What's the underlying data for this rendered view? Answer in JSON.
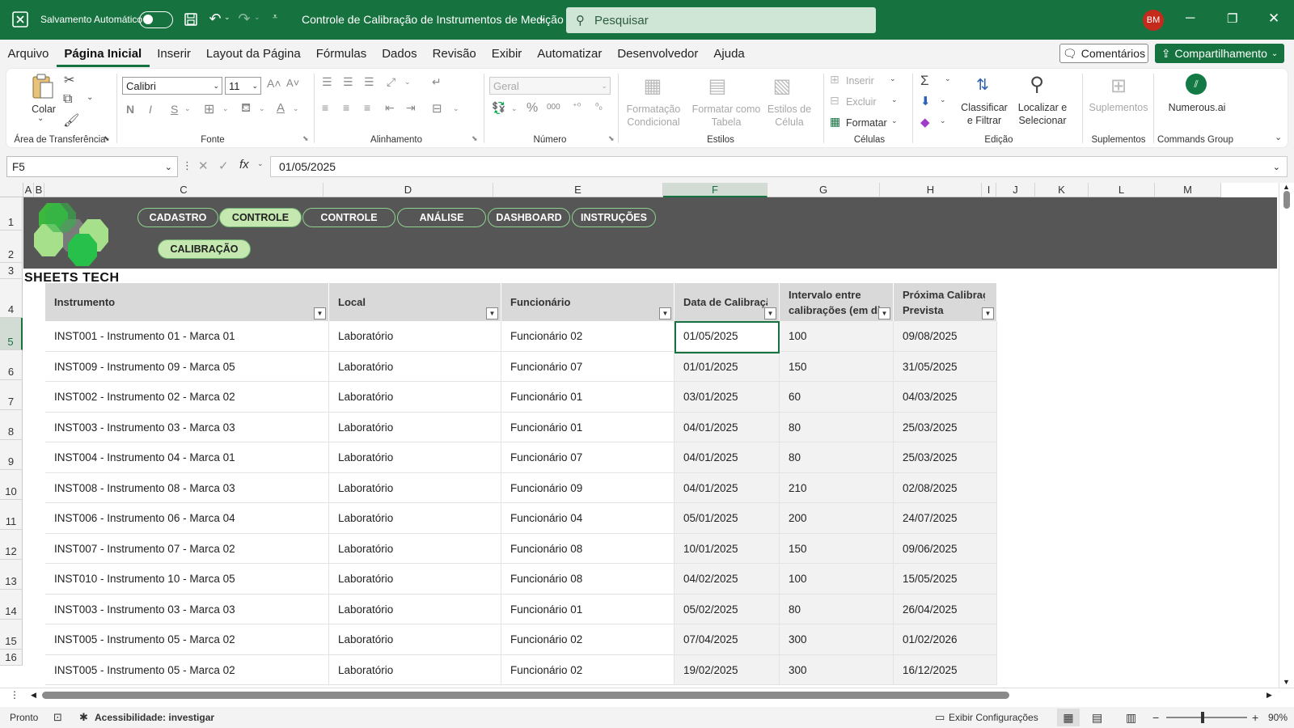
{
  "titlebar": {
    "autosave_label": "Salvamento Automático",
    "doc_title": "Controle de Calibração de Instrumentos de Medição",
    "search_placeholder": "Pesquisar",
    "user_initials": "BM"
  },
  "menu": [
    "Arquivo",
    "Página Inicial",
    "Inserir",
    "Layout da Página",
    "Fórmulas",
    "Dados",
    "Revisão",
    "Exibir",
    "Automatizar",
    "Desenvolvedor",
    "Ajuda"
  ],
  "menu_active_index": 1,
  "actions": {
    "comments": "Comentários",
    "share": "Compartilhamento"
  },
  "ribbon": {
    "clipboard": {
      "paste": "Colar",
      "label": "Área de Transferência"
    },
    "font": {
      "name": "Calibri",
      "size": "11",
      "label": "Fonte",
      "bold": "N",
      "italic": "I",
      "underline": "S"
    },
    "alignment": {
      "label": "Alinhamento"
    },
    "number": {
      "format": "Geral",
      "label": "Número"
    },
    "styles": {
      "cond_format": "Formatação Condicional",
      "format_table": "Formatar como Tabela",
      "cell_styles": "Estilos de Célula",
      "label": "Estilos"
    },
    "cells": {
      "insert": "Inserir",
      "delete": "Excluir",
      "format": "Formatar",
      "label": "Células"
    },
    "editing": {
      "sort": "Classificar e Filtrar",
      "find": "Localizar e Selecionar",
      "label": "Edição"
    },
    "addins": {
      "addins": "Suplementos",
      "label": "Suplementos"
    },
    "commands": {
      "numerous": "Numerous.ai",
      "label": "Commands Group"
    }
  },
  "formula_bar": {
    "name_box": "F5",
    "formula": "01/05/2025"
  },
  "columns": [
    "A",
    "B",
    "C",
    "D",
    "E",
    "F",
    "G",
    "H",
    "I",
    "J",
    "K",
    "L",
    "M"
  ],
  "rows": [
    "1",
    "2",
    "3",
    "4",
    "5",
    "6",
    "7",
    "8",
    "9",
    "10",
    "11",
    "12",
    "13",
    "14",
    "15",
    "16"
  ],
  "banner": {
    "nav": [
      "CADASTRO",
      "CONTROLE",
      "CONTROLE",
      "ANÁLISE",
      "DASHBOARD",
      "INSTRUÇÕES"
    ],
    "nav_active": "CONTROLE",
    "sub_button": "CALIBRAÇÃO",
    "brand": "SHEETS TECH"
  },
  "table": {
    "headers": [
      "Instrumento",
      "Local",
      "Funcionário",
      "Data de Calibração",
      "Intervalo entre calibrações (em dias)",
      "Próxima Calibração Prevista"
    ],
    "header_lines": [
      [
        "Instrumento"
      ],
      [
        "Local"
      ],
      [
        "Funcionário"
      ],
      [
        "Data de Calibração"
      ],
      [
        "Intervalo entre",
        "calibrações (em dia"
      ],
      [
        "Próxima Calibração",
        "Prevista"
      ]
    ],
    "rows": [
      [
        "INST001 - Instrumento 01 - Marca 01",
        "Laboratório",
        "Funcionário 02",
        "01/05/2025",
        "100",
        "09/08/2025"
      ],
      [
        "INST009 - Instrumento 09 - Marca 05",
        "Laboratório",
        "Funcionário 07",
        "01/01/2025",
        "150",
        "31/05/2025"
      ],
      [
        "INST002 - Instrumento 02 - Marca 02",
        "Laboratório",
        "Funcionário 01",
        "03/01/2025",
        "60",
        "04/03/2025"
      ],
      [
        "INST003 - Instrumento 03 - Marca 03",
        "Laboratório",
        "Funcionário 01",
        "04/01/2025",
        "80",
        "25/03/2025"
      ],
      [
        "INST004 - Instrumento 04 - Marca 01",
        "Laboratório",
        "Funcionário 07",
        "04/01/2025",
        "80",
        "25/03/2025"
      ],
      [
        "INST008 - Instrumento 08 - Marca 03",
        "Laboratório",
        "Funcionário 09",
        "04/01/2025",
        "210",
        "02/08/2025"
      ],
      [
        "INST006 - Instrumento 06 - Marca 04",
        "Laboratório",
        "Funcionário 04",
        "05/01/2025",
        "200",
        "24/07/2025"
      ],
      [
        "INST007 - Instrumento 07 - Marca 02",
        "Laboratório",
        "Funcionário 08",
        "10/01/2025",
        "150",
        "09/06/2025"
      ],
      [
        "INST010 - Instrumento 10 - Marca 05",
        "Laboratório",
        "Funcionário 08",
        "04/02/2025",
        "100",
        "15/05/2025"
      ],
      [
        "INST003 - Instrumento 03 - Marca 03",
        "Laboratório",
        "Funcionário 01",
        "05/02/2025",
        "80",
        "26/04/2025"
      ],
      [
        "INST005 - Instrumento 05 - Marca 02",
        "Laboratório",
        "Funcionário 02",
        "07/04/2025",
        "300",
        "01/02/2026"
      ],
      [
        "INST005 - Instrumento 05 - Marca 02",
        "Laboratório",
        "Funcionário 02",
        "19/02/2025",
        "300",
        "16/12/2025"
      ]
    ]
  },
  "status": {
    "ready": "Pronto",
    "accessibility": "Acessibilidade: investigar",
    "display_settings": "Exibir Configurações",
    "zoom": "90%"
  },
  "colors": {
    "excel_green": "#16733f",
    "banner_gray": "#565656",
    "header_gray": "#d9d9d9"
  }
}
